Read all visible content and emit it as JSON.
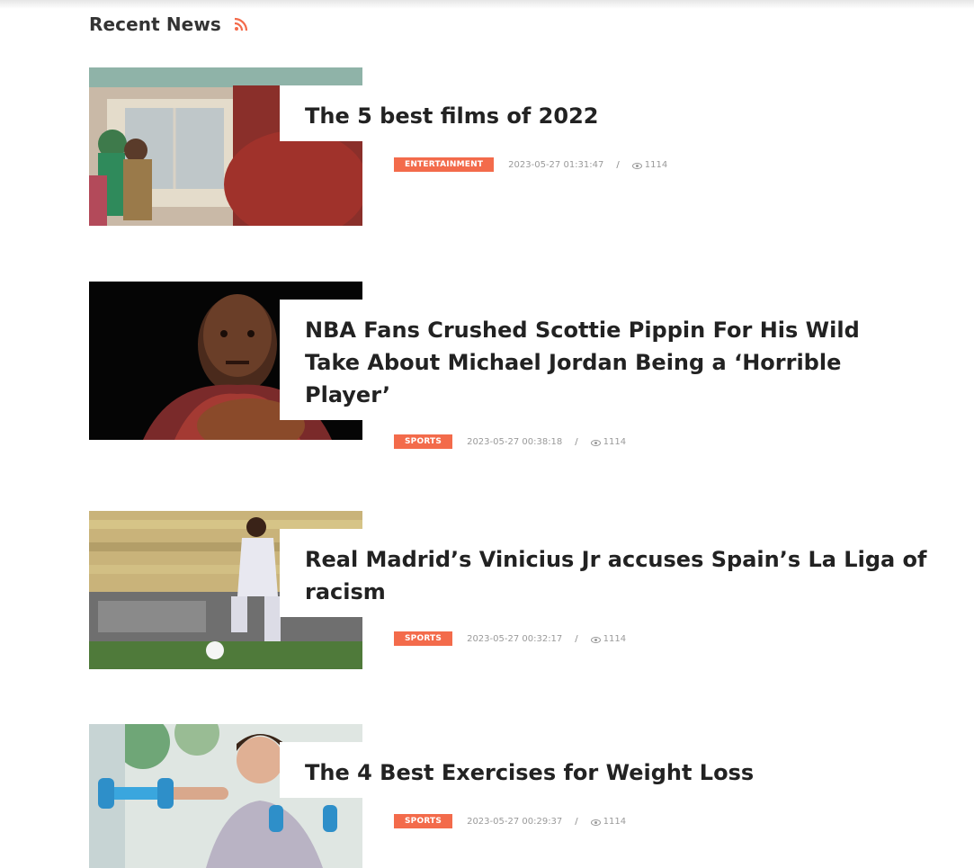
{
  "header": {
    "title": "Recent News",
    "icon": "rss-icon",
    "accent_color": "#f36b4b"
  },
  "news": [
    {
      "title": "The 5 best films of 2022",
      "category": "ENTERTAINMENT",
      "datetime": "2023-05-27 01:31:47",
      "views": "1114",
      "image": "animated-film-still"
    },
    {
      "title": "NBA Fans Crushed Scottie Pippin For His Wild Take About Michael Jordan Being a ‘Horrible Player’",
      "category": "SPORTS",
      "datetime": "2023-05-27 00:38:18",
      "views": "1114",
      "image": "basketball-player-portrait"
    },
    {
      "title": "Real Madrid’s Vinicius Jr accuses Spain’s La Liga of racism",
      "category": "SPORTS",
      "datetime": "2023-05-27 00:32:17",
      "views": "1114",
      "image": "football-player-on-pitch"
    },
    {
      "title": "The 4 Best Exercises for Weight Loss",
      "category": "SPORTS",
      "datetime": "2023-05-27 00:29:37",
      "views": "1114",
      "image": "woman-with-dumbbells"
    }
  ]
}
